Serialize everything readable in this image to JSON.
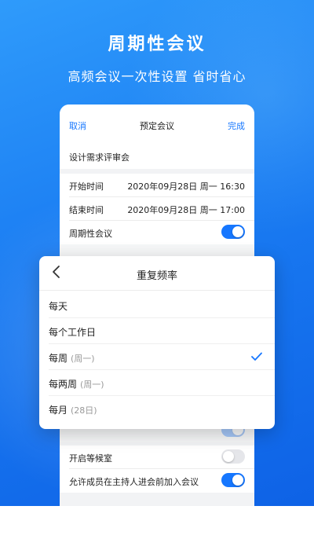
{
  "promo": {
    "headline": "周期性会议",
    "subline": "高频会议一次性设置 省时省心"
  },
  "navbar": {
    "cancel_label": "取消",
    "title": "预定会议",
    "done_label": "完成"
  },
  "meeting": {
    "subject": "设计需求评审会",
    "start_label": "开始时间",
    "start_value": "2020年09月28日  周一  16:30",
    "end_label": "结束时间",
    "end_value": "2020年09月28日  周一  17:00",
    "recurring_label": "周期性会议",
    "recurring_on": true
  },
  "settings": {
    "waiting_room_label": "开启等候室",
    "waiting_room_on": false,
    "join_before_host_label": "允许成员在主持人进会前加入会议",
    "join_before_host_on": true
  },
  "repeat_sheet": {
    "title": "重复频率",
    "selected_index": 2,
    "options": [
      {
        "label": "每天",
        "detail": ""
      },
      {
        "label": "每个工作日",
        "detail": ""
      },
      {
        "label": "每周",
        "detail": "(周一)"
      },
      {
        "label": "每两周",
        "detail": "(周一)"
      },
      {
        "label": "每月",
        "detail": "(28日)"
      }
    ]
  },
  "colors": {
    "accent": "#1677ff",
    "background_gradient_start": "#2f9bfb",
    "background_gradient_end": "#0e62e6"
  }
}
